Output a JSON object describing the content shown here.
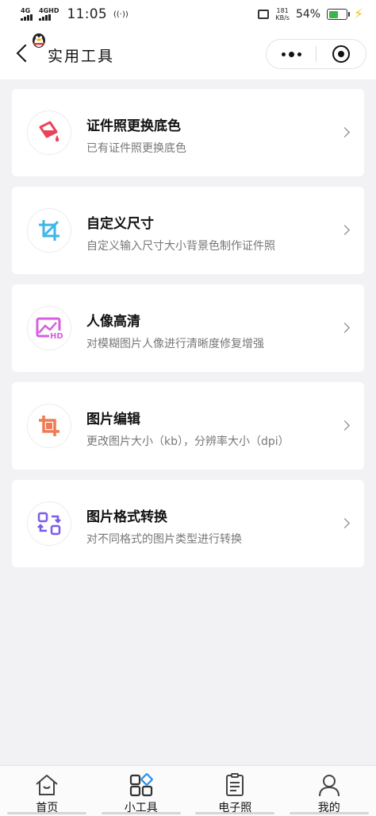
{
  "status_bar": {
    "net1": "4G",
    "net2": "4GHD",
    "time": "11:05",
    "hotspot": "((·))",
    "speed_value": "181",
    "speed_unit": "KB/s",
    "battery_pct": "54%",
    "battery_level": 0.54
  },
  "nav": {
    "title": "实用工具"
  },
  "tools": [
    {
      "title": "证件照更换底色",
      "subtitle": "已有证件照更换底色",
      "icon": "paint-bucket-icon",
      "color": "#e9455a"
    },
    {
      "title": "自定义尺寸",
      "subtitle": "自定义输入尺寸大小背景色制作证件照",
      "icon": "crop-icon",
      "color": "#3cb6e6"
    },
    {
      "title": "人像高清",
      "subtitle": "对模糊图片人像进行清晰度修复增强",
      "icon": "hd-image-icon",
      "color": "#d660e0"
    },
    {
      "title": "图片编辑",
      "subtitle": "更改图片大小（kb），分辨率大小（dpi）",
      "icon": "crop-edit-icon",
      "color": "#f07a52"
    },
    {
      "title": "图片格式转换",
      "subtitle": "对不同格式的图片类型进行转换",
      "icon": "format-convert-icon",
      "color": "#7b5bea"
    }
  ],
  "tabs": [
    {
      "label": "首页",
      "icon": "home-icon"
    },
    {
      "label": "小工具",
      "icon": "tools-grid-icon"
    },
    {
      "label": "电子照",
      "icon": "document-icon"
    },
    {
      "label": "我的",
      "icon": "user-icon"
    }
  ]
}
